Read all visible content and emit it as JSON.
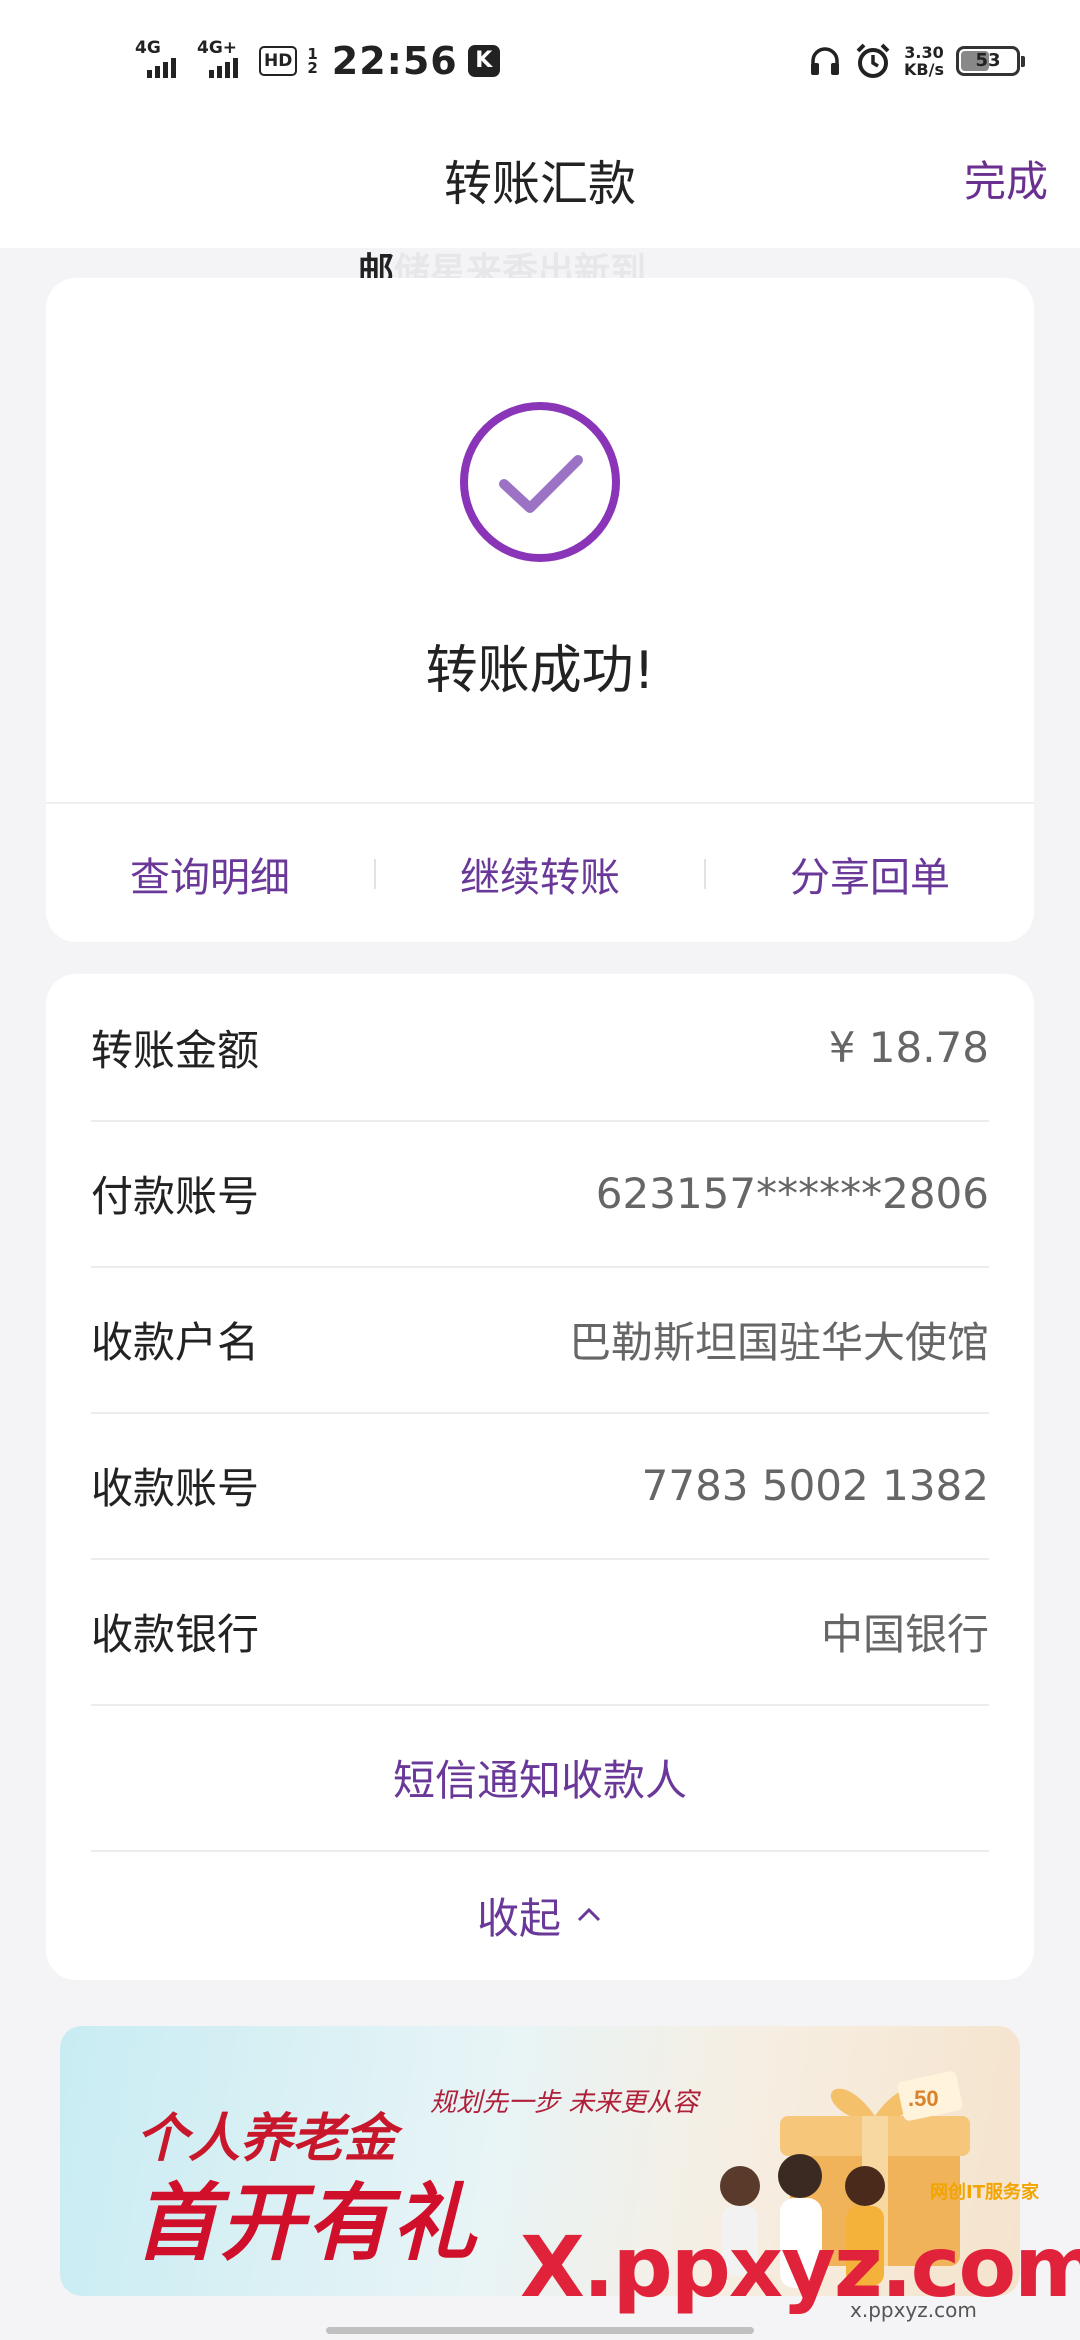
{
  "status_bar": {
    "signal1": "4G",
    "signal2": "4G+",
    "hd": "HD",
    "hd_num1": "1",
    "hd_num2": "2",
    "time": "22:56",
    "k_icon": "K",
    "speed_value": "3.30",
    "speed_unit": "KB/s",
    "battery": "53"
  },
  "nav": {
    "title": "转账汇款",
    "done": "完成"
  },
  "marquee": {
    "prefix": "邮",
    "ghost": "储星来香出新到"
  },
  "result": {
    "success_text": "转账成功!",
    "accent_color": "#8e3fb8",
    "actions": [
      "查询明细",
      "继续转账",
      "分享回单"
    ]
  },
  "details": {
    "rows": [
      {
        "label": "转账金额",
        "value": "¥  18.78"
      },
      {
        "label": "付款账号",
        "value": "623157******2806"
      },
      {
        "label": "收款户名",
        "value": "巴勒斯坦国驻华大使馆"
      },
      {
        "label": "收款账号",
        "value": "7783 5002 1382"
      },
      {
        "label": "收款银行",
        "value": "中国银行"
      }
    ],
    "sms_link": "短信通知收款人",
    "collapse": "收起"
  },
  "banner": {
    "line1": "个人养老金",
    "line2": "首开有礼",
    "slogan": "规划先一步 未来更从容",
    "badge": ".50"
  },
  "watermark": {
    "text": "X.ppxyz.com",
    "small": "网创IT服务家",
    "url": "x.ppxyz.com"
  }
}
